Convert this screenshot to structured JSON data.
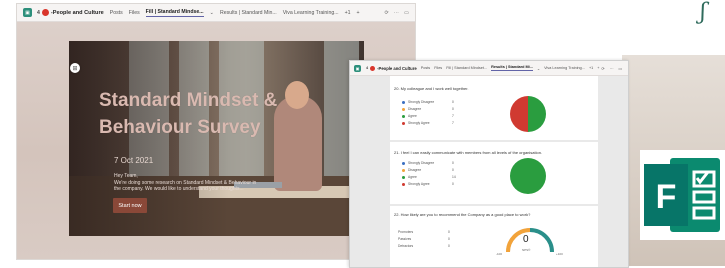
{
  "left_window": {
    "number": "4",
    "team_name": "-People and Culture",
    "tabs": [
      {
        "label": "Posts"
      },
      {
        "label": "Files"
      },
      {
        "label": "Fill | Standard Mindse...",
        "active": true
      },
      {
        "label": "Results | Standard Min..."
      },
      {
        "label": "Viva Learning Training..."
      },
      {
        "label": "+1"
      },
      {
        "label": "+"
      }
    ],
    "survey": {
      "title_line1": "Standard Mindset &",
      "title_line2": "Behaviour Survey",
      "date": "7 Oct 2021",
      "intro_line1": "Hey Team,",
      "intro_line2": "We're doing some research on Standard Mindset & Behaviour in the company. We would like to understand your thoughts...",
      "start_label": "Start now"
    }
  },
  "right_window": {
    "number": "4",
    "team_name": "-People and Culture",
    "tabs": [
      {
        "label": "Posts"
      },
      {
        "label": "Files"
      },
      {
        "label": "Fill | Standard Mindset..."
      },
      {
        "label": "Results | Standard Mi...",
        "active": true
      },
      {
        "label": "Viva Learning Training..."
      },
      {
        "label": "+1"
      },
      {
        "label": "+"
      }
    ],
    "questions": [
      {
        "title": "20.  My colleague and I work well together.",
        "legend": [
          {
            "label": "Strongly Disagree",
            "count": "0",
            "color": "#3b6fc1"
          },
          {
            "label": "Disagree",
            "count": "0",
            "color": "#f2a33a"
          },
          {
            "label": "Agree",
            "count": "7",
            "color": "#2a9d3f"
          },
          {
            "label": "Strongly Agree",
            "count": "7",
            "color": "#d03a31"
          }
        ]
      },
      {
        "title": "21.  I feel I can easily communicate with members from all levels of the organisation.",
        "legend": [
          {
            "label": "Strongly Disagree",
            "count": "0",
            "color": "#3b6fc1"
          },
          {
            "label": "Disagree",
            "count": "0",
            "color": "#f2a33a"
          },
          {
            "label": "Agree",
            "count": "14",
            "color": "#2a9d3f"
          },
          {
            "label": "Strongly Agree",
            "count": "0",
            "color": "#d03a31"
          }
        ]
      },
      {
        "title": "22.  How likely are you to recommend the Company as a good place to work?",
        "legend": [
          {
            "label": "Promoters",
            "count": "0"
          },
          {
            "label": "Passives",
            "count": "0"
          },
          {
            "label": "Detractors",
            "count": "0"
          }
        ],
        "nps": {
          "value": "0",
          "label": "NPS®",
          "min": "-100",
          "max": "+100"
        }
      }
    ]
  },
  "logo": {
    "name": "forms-logo",
    "letter": "F"
  },
  "colors": {
    "teams_accent": "#6264a7",
    "forms_green": "#077568",
    "start_button": "#8a4838"
  }
}
